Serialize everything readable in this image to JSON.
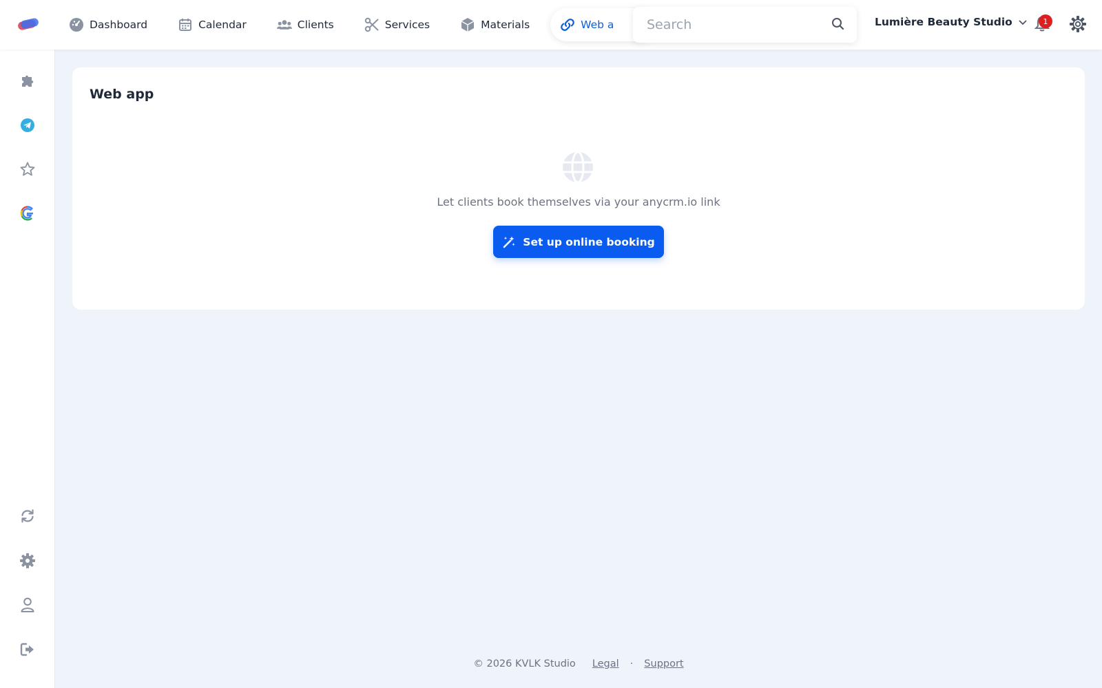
{
  "nav": {
    "items": [
      {
        "label": "Dashboard",
        "icon": "gauge-icon"
      },
      {
        "label": "Calendar",
        "icon": "calendar-icon"
      },
      {
        "label": "Clients",
        "icon": "users-icon"
      },
      {
        "label": "Services",
        "icon": "scissors-icon"
      },
      {
        "label": "Materials",
        "icon": "cube-icon"
      },
      {
        "label": "Web a",
        "icon": "link-icon",
        "active": true
      }
    ]
  },
  "search": {
    "placeholder": "Search",
    "value": ""
  },
  "account": {
    "studio_name": "Lumière Beauty Studio",
    "notifications": "1"
  },
  "sidebar": {
    "top_icons": [
      "puzzle-icon",
      "telegram-icon",
      "star-icon",
      "google-icon"
    ],
    "bottom_icons": [
      "sync-icon",
      "gear-icon",
      "user-icon",
      "logout-icon"
    ]
  },
  "main": {
    "title": "Web app",
    "empty_text": "Let clients book themselves via your anycrm.io link",
    "cta_label": "Set up online booking"
  },
  "footer": {
    "copyright": "© 2026 KVLK Studio",
    "separator": "·",
    "links": [
      "Legal",
      "Support"
    ]
  },
  "colors": {
    "accent": "#0a5cf0",
    "active_nav": "#0d5fd6",
    "badge": "#dc1f1f",
    "background": "#eff3fa",
    "telegram": "#37aee2"
  }
}
